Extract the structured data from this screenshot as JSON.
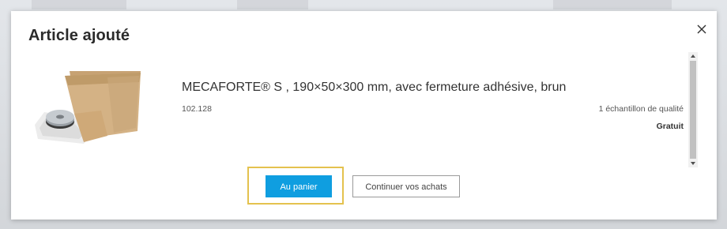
{
  "modal": {
    "title": "Article ajouté",
    "close_icon": "close-icon"
  },
  "product": {
    "name": "MECAFORTE® S , 190×50×300 mm, avec fermeture adhésive, brun",
    "sku": "102.128",
    "quantity_text": "1 échantillon de qualité",
    "price_text": "Gratuit",
    "image_alt": "padded-envelope-image"
  },
  "actions": {
    "add_to_cart_label": "Au panier",
    "continue_shopping_label": "Continuer vos achats"
  },
  "colors": {
    "primary_button": "#0f9ee0",
    "focus_outline": "#e4c24e",
    "backdrop": "#d6d9dd"
  }
}
